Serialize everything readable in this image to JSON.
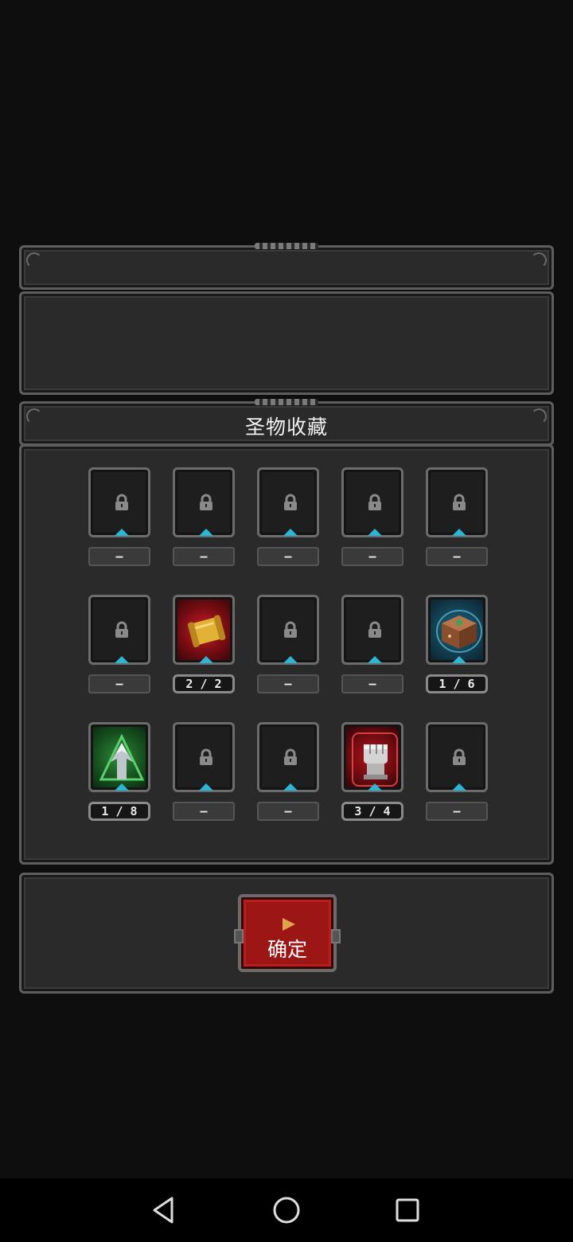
{
  "collection": {
    "title": "圣物收藏",
    "slots": [
      {
        "id": 1,
        "state": "locked",
        "count": "—"
      },
      {
        "id": 2,
        "state": "locked",
        "count": "—"
      },
      {
        "id": 3,
        "state": "locked",
        "count": "—"
      },
      {
        "id": 4,
        "state": "locked",
        "count": "—"
      },
      {
        "id": 5,
        "state": "locked",
        "count": "—"
      },
      {
        "id": 6,
        "state": "locked",
        "count": "—"
      },
      {
        "id": 7,
        "state": "owned",
        "icon": "golden-scroll-icon",
        "theme": "red",
        "count": "2 / 2"
      },
      {
        "id": 8,
        "state": "locked",
        "count": "—"
      },
      {
        "id": 9,
        "state": "locked",
        "count": "—"
      },
      {
        "id": 10,
        "state": "owned",
        "icon": "wooden-box-icon",
        "theme": "blue",
        "count": "1 / 6"
      },
      {
        "id": 11,
        "state": "owned",
        "icon": "silver-arrow-icon",
        "theme": "green",
        "count": "1 / 8"
      },
      {
        "id": 12,
        "state": "locked",
        "count": "—"
      },
      {
        "id": 13,
        "state": "locked",
        "count": "—"
      },
      {
        "id": 14,
        "state": "owned",
        "icon": "iron-fist-icon",
        "theme": "crimson",
        "count": "3 / 4"
      },
      {
        "id": 15,
        "state": "locked",
        "count": "—"
      }
    ]
  },
  "footer": {
    "confirm_label": "确定"
  },
  "colors": {
    "accent": "#9c1616",
    "indicator": "#2bb6d6"
  },
  "navbar": {
    "icons": [
      "back-icon",
      "home-icon",
      "recents-icon"
    ]
  }
}
